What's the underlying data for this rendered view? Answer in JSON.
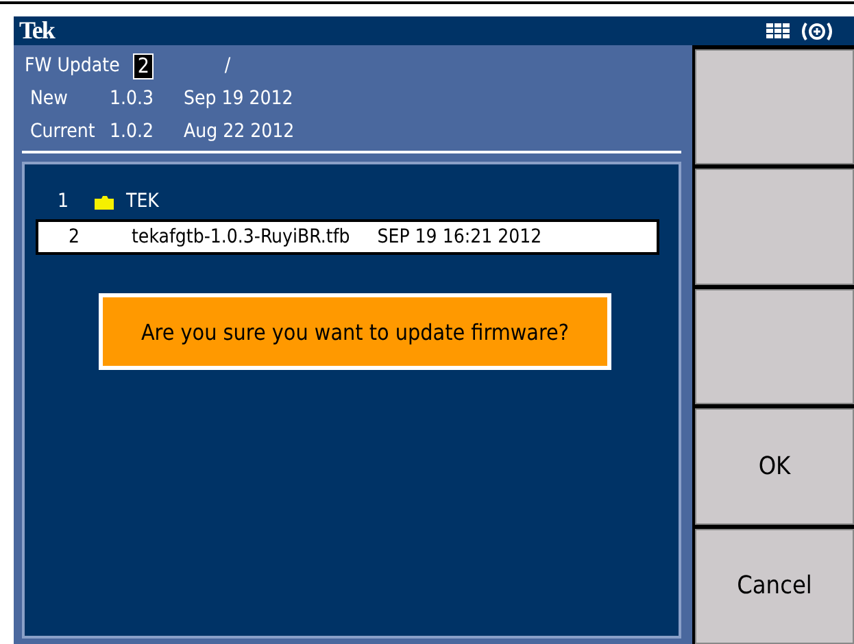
{
  "title_bar": {
    "logo": "Tek"
  },
  "header": {
    "label": "FW Update",
    "field_value": "2",
    "separator": "/",
    "versions": [
      {
        "label": "New",
        "version": "1.0.3",
        "date": "Sep 19 2012"
      },
      {
        "label": "Current",
        "version": "1.0.2",
        "date": "Aug 22 2012"
      }
    ]
  },
  "files": [
    {
      "kind": "folder",
      "index": "1",
      "name": "TEK",
      "selected": false
    },
    {
      "kind": "file",
      "index": "2",
      "name": "tekafgtb-1.0.3-RuyiBR.tfb",
      "date": "SEP 19 16:21 2012",
      "selected": true
    }
  ],
  "dialog": {
    "message": "Are you sure you want to update firmware?"
  },
  "softkeys": [
    {
      "kind": "blank"
    },
    {
      "kind": "blank"
    },
    {
      "kind": "blank"
    },
    {
      "kind": "labeled",
      "label": "OK"
    },
    {
      "kind": "labeled",
      "label": "Cancel"
    }
  ]
}
